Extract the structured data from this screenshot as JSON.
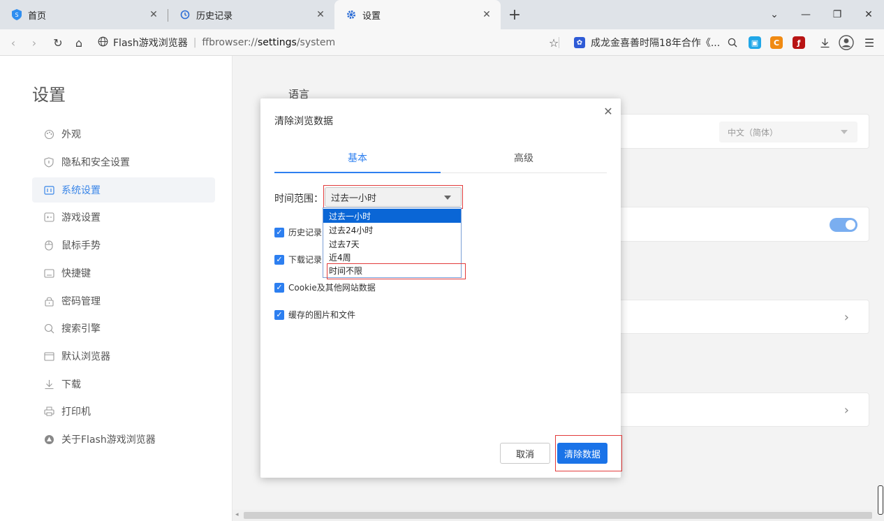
{
  "tabs": [
    {
      "label": "首页",
      "icon": "ffbrowser-logo-icon",
      "active": false
    },
    {
      "label": "历史记录",
      "icon": "history-icon",
      "active": false
    },
    {
      "label": "设置",
      "icon": "gear-icon",
      "active": true
    }
  ],
  "address_bar": {
    "site_name": "Flash游戏浏览器",
    "url_scheme": "ffbrowser://",
    "url_host": "settings",
    "url_path": "/system",
    "news_text": "成龙金喜善时隔18年合作《..."
  },
  "sidebar": {
    "title": "设置",
    "items": [
      {
        "label": "外观",
        "icon": "palette-icon",
        "active": false
      },
      {
        "label": "隐私和安全设置",
        "icon": "shield-icon",
        "active": false
      },
      {
        "label": "系统设置",
        "icon": "system-icon",
        "active": true
      },
      {
        "label": "游戏设置",
        "icon": "gamepad-icon",
        "active": false
      },
      {
        "label": "鼠标手势",
        "icon": "mouse-icon",
        "active": false
      },
      {
        "label": "快捷键",
        "icon": "keyboard-icon",
        "active": false
      },
      {
        "label": "密码管理",
        "icon": "lock-icon",
        "active": false
      },
      {
        "label": "搜索引擎",
        "icon": "search-icon",
        "active": false
      },
      {
        "label": "默认浏览器",
        "icon": "browser-window-icon",
        "active": false
      },
      {
        "label": "下载",
        "icon": "download-icon",
        "active": false
      },
      {
        "label": "打印机",
        "icon": "printer-icon",
        "active": false
      },
      {
        "label": "关于Flash游戏浏览器",
        "icon": "ffbrowser-logo-icon",
        "active": false
      }
    ]
  },
  "main": {
    "language_section_title": "语言",
    "language_value": "中文（简体）"
  },
  "dialog": {
    "title": "清除浏览数据",
    "tabs": [
      {
        "label": "基本",
        "active": true
      },
      {
        "label": "高级",
        "active": false
      }
    ],
    "time_range_label": "时间范围：",
    "time_range_selected": "过去一小时",
    "time_range_options": [
      "过去一小时",
      "过去24小时",
      "过去7天",
      "近4周",
      "时间不限"
    ],
    "checkboxes": [
      {
        "label": "历史记录",
        "checked": true
      },
      {
        "label": "下载记录",
        "checked": true
      },
      {
        "label": "Cookie及其他网站数据",
        "checked": true
      },
      {
        "label": "缓存的图片和文件",
        "checked": true
      }
    ],
    "cancel_label": "取消",
    "confirm_label": "清除数据"
  },
  "colors": {
    "accent": "#2d7ff0",
    "highlight_box": "#e23b3b",
    "selected_option": "#0a66d6"
  }
}
